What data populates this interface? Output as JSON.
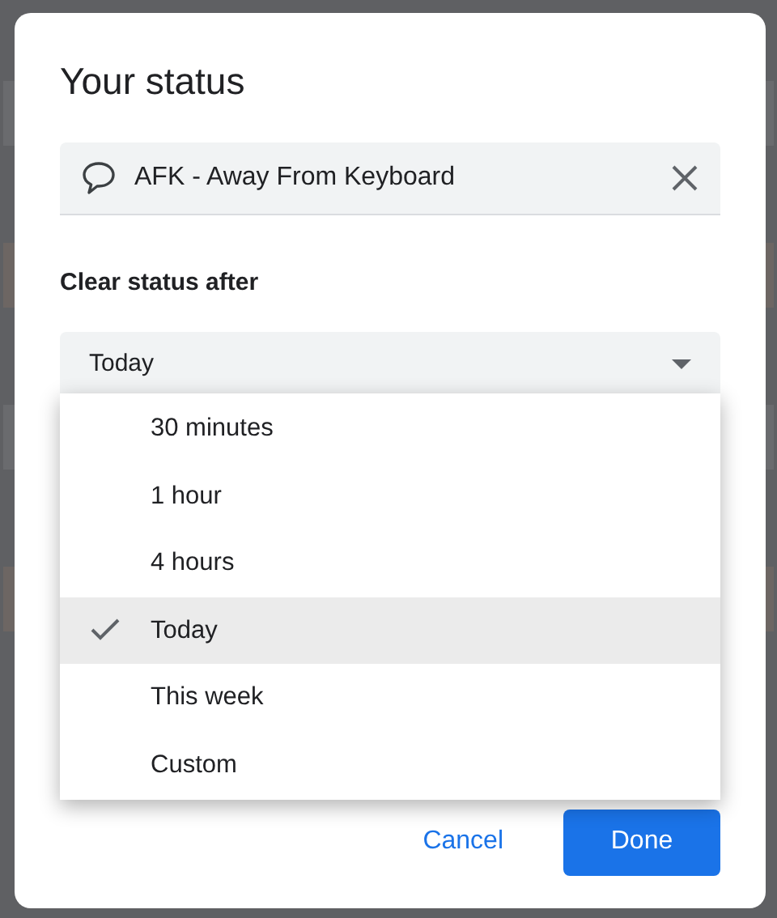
{
  "dialog": {
    "title": "Your status",
    "status_field": {
      "value": "AFK - Away From Keyboard"
    },
    "clear_after": {
      "label": "Clear status after",
      "value": "Today",
      "expanded": true,
      "options": [
        {
          "label": "30 minutes",
          "selected": false
        },
        {
          "label": "1 hour",
          "selected": false
        },
        {
          "label": "4 hours",
          "selected": false
        },
        {
          "label": "Today",
          "selected": true
        },
        {
          "label": "This week",
          "selected": false
        },
        {
          "label": "Custom",
          "selected": false
        }
      ]
    },
    "buttons": [
      {
        "label": "Cancel",
        "kind": "text"
      },
      {
        "label": "Done",
        "kind": "primary"
      }
    ]
  }
}
